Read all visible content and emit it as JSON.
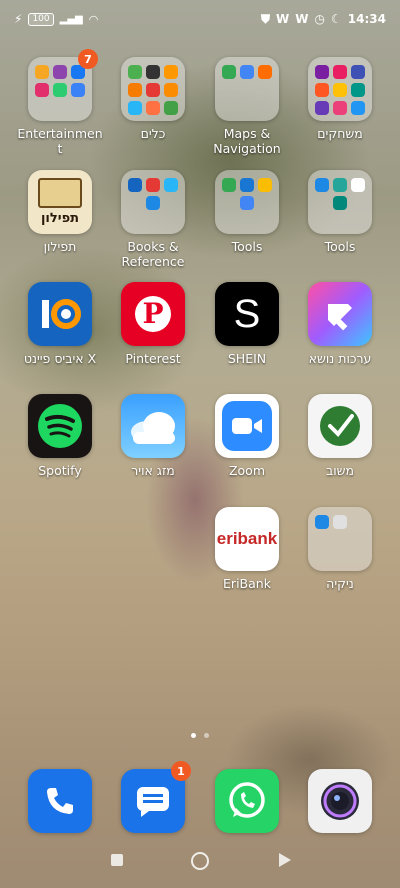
{
  "status_bar": {
    "battery": "100",
    "time": "14:34"
  },
  "apps": {
    "entertainment": {
      "label": "Entertainmen t",
      "badge": "7"
    },
    "tools_heb": {
      "label": "כלים"
    },
    "maps": {
      "label": "Maps & Navigation"
    },
    "games": {
      "label": "משחקים"
    },
    "tefilon": {
      "label": "תפילון",
      "icon_text": "תפילון"
    },
    "books": {
      "label": "Books & Reference"
    },
    "tools1": {
      "label": "Tools"
    },
    "tools2": {
      "label": "Tools"
    },
    "ibis": {
      "label": "איביס פיינט X"
    },
    "pinterest": {
      "label": "Pinterest"
    },
    "shein": {
      "label": "SHEIN",
      "icon_text": "S"
    },
    "theme": {
      "label": "ערכות נושא"
    },
    "spotify": {
      "label": "Spotify"
    },
    "weather": {
      "label": "מזג אויר"
    },
    "zoom": {
      "label": "Zoom"
    },
    "mashov": {
      "label": "משוב"
    },
    "eribank": {
      "label": "EriBank",
      "icon_text": "eribank"
    },
    "cleaner": {
      "label": "ניקיה"
    }
  },
  "dock": {
    "messages_badge": "1"
  },
  "colors": {
    "badge": "#f05a22",
    "pinterest": "#e60023",
    "spotify_bg": "#191414",
    "spotify_green": "#1ed760",
    "whatsapp": "#25d366",
    "phone": "#1a73e8"
  }
}
